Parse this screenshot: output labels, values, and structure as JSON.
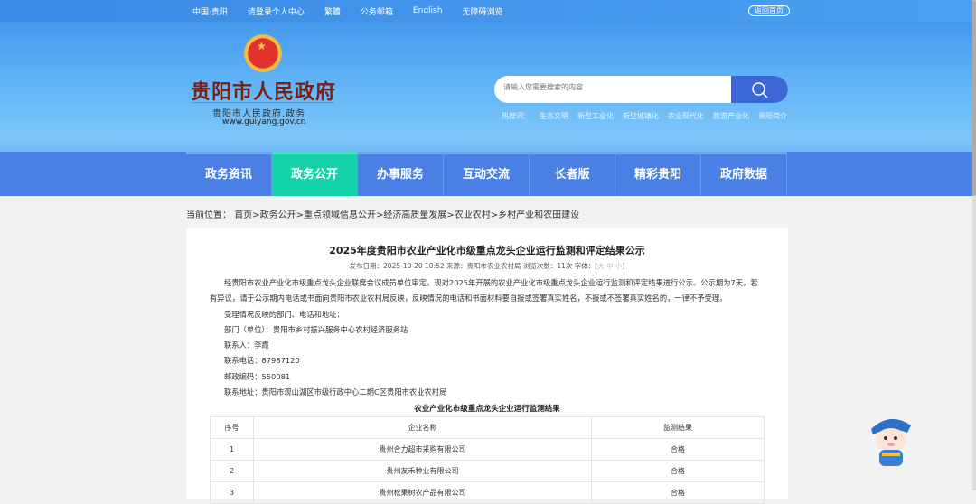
{
  "topbar": {
    "items": [
      "中国·贵阳",
      "请登录个人中心",
      "繁體",
      "公务邮箱",
      "English",
      "无障碍浏览"
    ],
    "back_home": "返回首页"
  },
  "logo": {
    "title": "贵阳市人民政府",
    "subtitle": "贵阳市人民政府.政务",
    "url": "www.guiyang.gov.cn"
  },
  "search": {
    "placeholder": "请输入您需要搜索的内容",
    "hot_label": "热搜词：",
    "hot": [
      "生态文明",
      "新型工业化",
      "新型城镇化",
      "农业现代化",
      "旅游产业化",
      "贵阳简介"
    ]
  },
  "nav": {
    "tabs": [
      "政务资讯",
      "政务公开",
      "办事服务",
      "互动交流",
      "长者版",
      "精彩贵阳",
      "政府数据"
    ],
    "active": "政务公开"
  },
  "breadcrumb": {
    "label": "当前位置：",
    "path": "首页>政务公开>重点领域信息公开>经济高质量发展>农业农村>乡村产业和农田建设"
  },
  "article": {
    "title": "2025年度贵阳市农业产业化市级重点龙头企业运行监测和评定结果公示",
    "meta": "发布日期：2025-10-20 10:52 来源：贵阳市农业农村局 浏览次数：11次 字体：[",
    "font_sizes": [
      "大",
      "中",
      "小"
    ],
    "meta_end": "]",
    "paragraphs": [
      "经贵阳市农业产业化市级重点龙头企业联席会议成员单位审定，现对2025年开展的农业产业化市级重点龙头企业运行监测和评定结果进行公示。公示期为7天，若有异议，请于公示期内电话或书面向贵阳市农业农村局反映，反映情况的电话和书面材料要自报或签署真实姓名，不报或不签署真实姓名的，一律不予受理。",
      "受理情况反映的部门、电话和地址：",
      "部门（单位）：贵阳市乡村振兴服务中心农村经济服务站",
      "联系人：李霞",
      "联系电话：87987120",
      "邮政编码：550081",
      "联系地址：贵阳市观山湖区市级行政中心二期C区贵阳市农业农村局"
    ],
    "table_title": "农业产业化市级重点龙头企业运行监测结果",
    "table": {
      "headers": [
        "序号",
        "企业名称",
        "监测结果"
      ],
      "rows": [
        [
          "1",
          "贵州合力超市采购有限公司",
          "合格"
        ],
        [
          "2",
          "贵州友禾种业有限公司",
          "合格"
        ],
        [
          "3",
          "贵州松果树农产品有限公司",
          "合格"
        ]
      ]
    }
  },
  "colors": {
    "nav": "#4a7fe6",
    "active_tab": "#14d2aa",
    "search_button": "#3d66d6"
  }
}
